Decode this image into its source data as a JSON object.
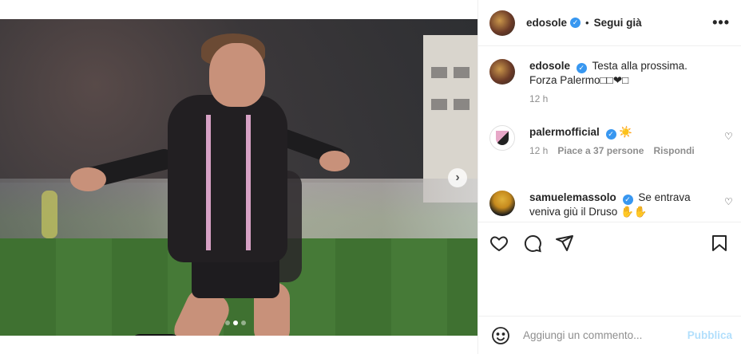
{
  "post": {
    "author": "edosole",
    "follow_label": "Segui già",
    "more_glyph": "•••",
    "separator": "•"
  },
  "caption": {
    "author": "edosole",
    "line1": "Testa alla prossima.",
    "line2": "Forza Palermo□□❤□",
    "time": "12 h"
  },
  "comments": [
    {
      "author": "palermofficial",
      "text": "☀️",
      "time": "12 h",
      "likes": "Piace a 37 persone",
      "reply": "Rispondi"
    },
    {
      "author": "samuelemassolo",
      "text_line1": "Se entrava",
      "text_line2": "veniva giù il Druso ✋✋"
    }
  ],
  "add_comment": {
    "placeholder": "Aggiungi un commento...",
    "publish_label": "Pubblica"
  },
  "media": {
    "next_glyph": "›",
    "dots": 3,
    "active_dot": 1
  },
  "icons": {
    "like": "heart-icon",
    "comment": "comment-icon",
    "share": "share-icon",
    "save": "bookmark-icon",
    "emoji": "emoji-icon",
    "verified": "verified-badge-icon"
  },
  "colors": {
    "verified": "#3897f0",
    "publish_disabled": "#b2dffc",
    "meta_gray": "#8e8e8e"
  }
}
